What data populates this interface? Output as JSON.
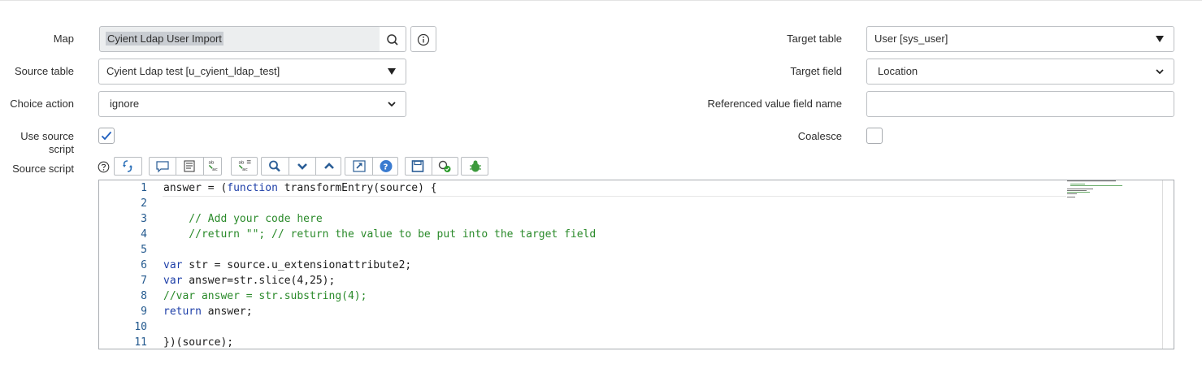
{
  "form": {
    "map": {
      "label": "Map",
      "value": "Cyient Ldap User Import"
    },
    "source_table": {
      "label": "Source table",
      "value": "Cyient Ldap test [u_cyient_ldap_test]"
    },
    "choice_action": {
      "label": "Choice action",
      "value": "ignore"
    },
    "use_source_script": {
      "label": "Use source script",
      "checked": true
    },
    "source_script": {
      "label": "Source script"
    },
    "target_table": {
      "label": "Target table",
      "value": "User [sys_user]"
    },
    "target_field": {
      "label": "Target field",
      "value": "Location"
    },
    "referenced_value_field_name": {
      "label": "Referenced value field name",
      "value": ""
    },
    "coalesce": {
      "label": "Coalesce",
      "checked": false
    }
  },
  "toolbar": {
    "buttons": [
      "format-code-icon",
      "toggle-comment-icon",
      "insert-script-icon",
      "replace-icon",
      "replace-all-icon",
      "search-icon",
      "search-next-icon",
      "search-prev-icon",
      "fullscreen-icon",
      "help-icon",
      "save-icon",
      "script-debug-icon",
      "debugger-icon"
    ]
  },
  "editor": {
    "line_numbers": [
      "1",
      "2",
      "3",
      "4",
      "5",
      "6",
      "7",
      "8",
      "9",
      "10",
      "11"
    ],
    "lines": [
      "answer = (function transformEntry(source) {",
      "",
      "    // Add your code here",
      "    //return \"\"; // return the value to be put into the target field",
      "",
      "var str = source.u_extensionattribute2;",
      "var answer=str.slice(4,25);",
      "//var answer = str.substring(4);",
      "return answer;",
      "",
      "})(source);"
    ]
  },
  "colors": {
    "keyword": "#1e3fa8",
    "comment": "#2a8a2a",
    "line_number": "#23598e",
    "checkbox_check": "#1f5fbf"
  }
}
